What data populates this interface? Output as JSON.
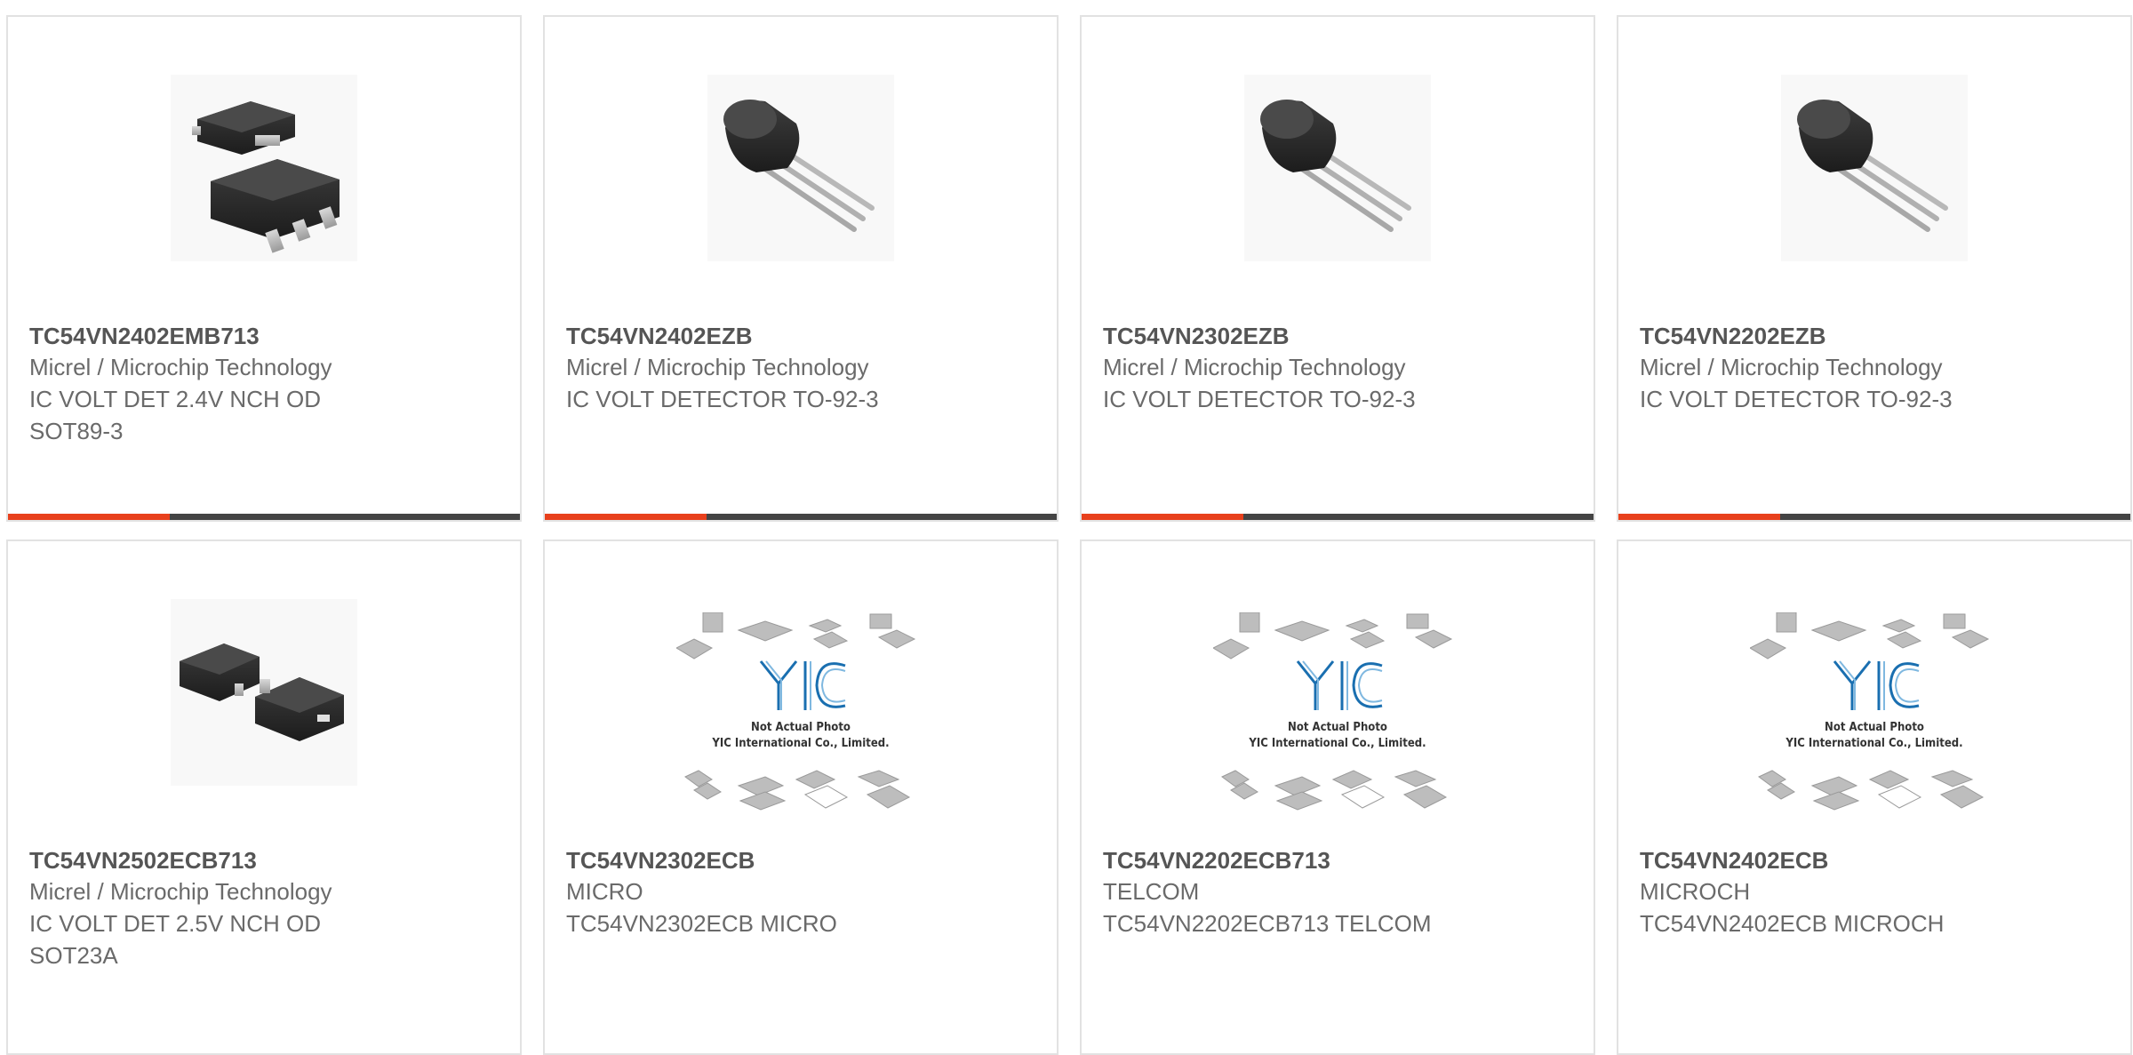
{
  "products": [
    {
      "image": "sot89-package-icon",
      "part_number": "TC54VN2402EMB713",
      "manufacturer": "Micrel / Microchip Technology",
      "description": "IC VOLT DET 2.4V NCH OD\nSOT89-3"
    },
    {
      "image": "to92-package-icon",
      "part_number": "TC54VN2402EZB",
      "manufacturer": "Micrel / Microchip Technology",
      "description": "IC VOLT DETECTOR TO-92-3"
    },
    {
      "image": "to92-package-icon",
      "part_number": "TC54VN2302EZB",
      "manufacturer": "Micrel / Microchip Technology",
      "description": "IC VOLT DETECTOR TO-92-3"
    },
    {
      "image": "to92-package-icon",
      "part_number": "TC54VN2202EZB",
      "manufacturer": "Micrel / Microchip Technology",
      "description": "IC VOLT DETECTOR TO-92-3"
    },
    {
      "image": "sot23-package-icon",
      "part_number": "TC54VN2502ECB713",
      "manufacturer": "Micrel / Microchip Technology",
      "description": "IC VOLT DET 2.5V NCH OD\nSOT23A"
    },
    {
      "image": "placeholder-photo-icon",
      "part_number": "TC54VN2302ECB",
      "manufacturer": "MICRO",
      "description": "TC54VN2302ECB MICRO"
    },
    {
      "image": "placeholder-photo-icon",
      "part_number": "TC54VN2202ECB713",
      "manufacturer": "TELCOM",
      "description": "TC54VN2202ECB713 TELCOM"
    },
    {
      "image": "placeholder-photo-icon",
      "part_number": "TC54VN2402ECB",
      "manufacturer": "MICROCH",
      "description": "TC54VN2402ECB MICROCH"
    }
  ],
  "placeholder": {
    "line1": "Not Actual Photo",
    "line2": "YIC International Co., Limited."
  },
  "colors": {
    "accent": "#e8401c",
    "bar": "#444444",
    "card_border": "#e2e2e2"
  }
}
